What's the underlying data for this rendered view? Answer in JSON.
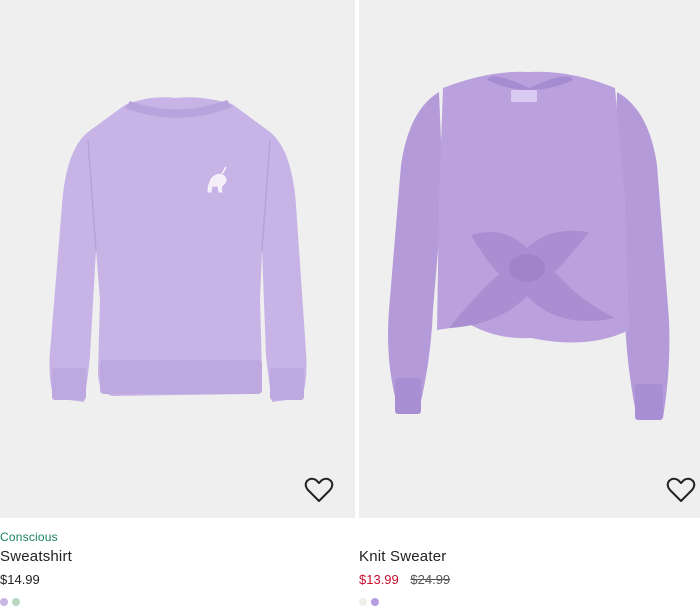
{
  "products": [
    {
      "tag": "Conscious",
      "name": "Sweatshirt",
      "price": "$14.99",
      "old_price": "",
      "swatches": [
        "#c9b6e4",
        "#b9d8c0"
      ]
    },
    {
      "tag": "",
      "name": "Knit Sweater",
      "price": "$13.99",
      "old_price": "$24.99",
      "swatches": [
        "#f1efe9",
        "#b69ce0"
      ]
    }
  ],
  "colors": {
    "sweatshirt": "#c7b3e6",
    "knit": "#b49ad9",
    "background": "#efefef",
    "sale": "#c8102e",
    "conscious": "#1a7f64"
  },
  "icons": {
    "favorite": "heart-outline-icon",
    "logo_print": "unicorn-icon"
  }
}
